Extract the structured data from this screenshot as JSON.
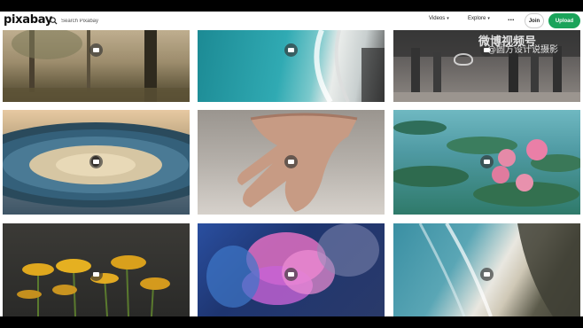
{
  "brand": {
    "name": "pixabay"
  },
  "search": {
    "placeholder": "Search Pixabay"
  },
  "nav": {
    "media_type": "Videos",
    "explore": "Explore",
    "more": "...",
    "join": "Join",
    "upload": "Upload"
  },
  "watermark": {
    "line1": "微博视频号",
    "line2": "@圆方设计说摄影"
  },
  "tiles": [
    {
      "name": "tile-forest-sunlight"
    },
    {
      "name": "tile-aerial-beach"
    },
    {
      "name": "tile-crowd-street"
    },
    {
      "name": "tile-vinyl-record"
    },
    {
      "name": "tile-hand-sand"
    },
    {
      "name": "tile-water-lilies"
    },
    {
      "name": "tile-yellow-flowers"
    },
    {
      "name": "tile-pink-smoke"
    },
    {
      "name": "tile-coastline-aerial"
    }
  ]
}
